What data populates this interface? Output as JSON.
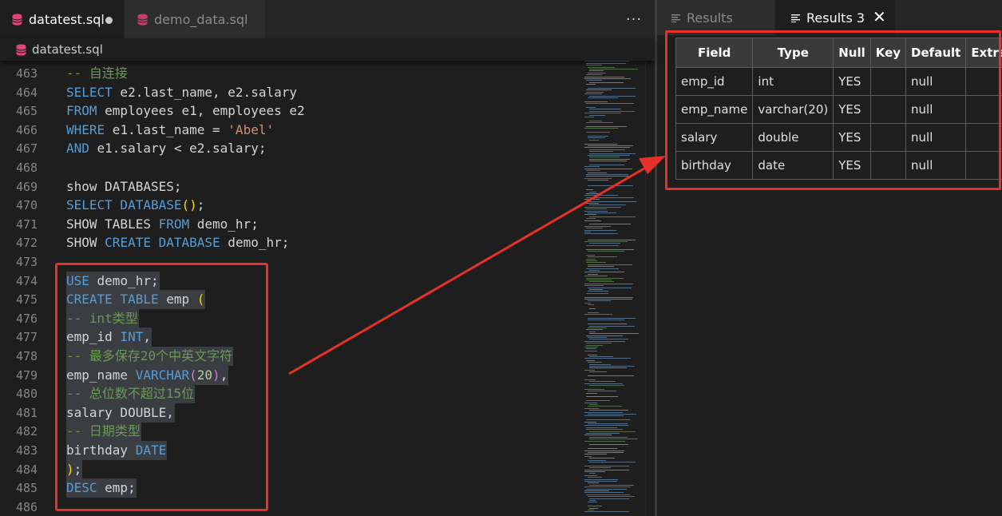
{
  "editor": {
    "tabs": [
      {
        "label": "datatest.sql",
        "active": true,
        "dirty": true
      },
      {
        "label": "demo_data.sql",
        "active": false,
        "dirty": false
      }
    ],
    "more_label": "···",
    "breadcrumb": "datatest.sql",
    "lines": [
      {
        "no": "463",
        "tokens": [
          {
            "c": "c",
            "t": "-- 自连接"
          }
        ]
      },
      {
        "no": "464",
        "tokens": [
          {
            "c": "k",
            "t": "SELECT"
          },
          {
            "c": "t",
            "t": " e2.last_name, e2.salary"
          }
        ]
      },
      {
        "no": "465",
        "tokens": [
          {
            "c": "k",
            "t": "FROM"
          },
          {
            "c": "t",
            "t": " employees e1, employees e2"
          }
        ]
      },
      {
        "no": "466",
        "tokens": [
          {
            "c": "k",
            "t": "WHERE"
          },
          {
            "c": "t",
            "t": " e1.last_name = "
          },
          {
            "c": "s",
            "t": "'Abel'"
          }
        ]
      },
      {
        "no": "467",
        "tokens": [
          {
            "c": "k",
            "t": "AND"
          },
          {
            "c": "t",
            "t": " e1.salary < e2.salary;"
          }
        ]
      },
      {
        "no": "468",
        "tokens": []
      },
      {
        "no": "469",
        "tokens": [
          {
            "c": "t",
            "t": "show DATABASES;"
          }
        ]
      },
      {
        "no": "470",
        "tokens": [
          {
            "c": "k",
            "t": "SELECT DATABASE"
          },
          {
            "c": "b",
            "t": "()"
          },
          {
            "c": "t",
            "t": ";"
          }
        ]
      },
      {
        "no": "471",
        "tokens": [
          {
            "c": "t",
            "t": "SHOW TABLES "
          },
          {
            "c": "k",
            "t": "FROM"
          },
          {
            "c": "t",
            "t": " demo_hr;"
          }
        ]
      },
      {
        "no": "472",
        "tokens": [
          {
            "c": "t",
            "t": "SHOW "
          },
          {
            "c": "k",
            "t": "CREATE DATABASE"
          },
          {
            "c": "t",
            "t": " demo_hr;"
          }
        ]
      },
      {
        "no": "473",
        "tokens": []
      },
      {
        "no": "474",
        "sel": true,
        "tokens": [
          {
            "c": "k",
            "t": "USE"
          },
          {
            "c": "t",
            "t": " demo_hr;"
          }
        ]
      },
      {
        "no": "475",
        "sel": true,
        "tokens": [
          {
            "c": "k",
            "t": "CREATE TABLE"
          },
          {
            "c": "t",
            "t": " emp "
          },
          {
            "c": "b",
            "t": "("
          }
        ]
      },
      {
        "no": "476",
        "sel": true,
        "tokens": [
          {
            "c": "c",
            "t": "-- int类型"
          }
        ]
      },
      {
        "no": "477",
        "sel": true,
        "tokens": [
          {
            "c": "t",
            "t": "emp_id "
          },
          {
            "c": "k",
            "t": "INT"
          },
          {
            "c": "t",
            "t": ","
          }
        ]
      },
      {
        "no": "478",
        "sel": true,
        "tokens": [
          {
            "c": "c",
            "t": "-- 最多保存20个中英文字符"
          }
        ]
      },
      {
        "no": "479",
        "sel": true,
        "tokens": [
          {
            "c": "t",
            "t": "emp_name "
          },
          {
            "c": "k",
            "t": "VARCHAR"
          },
          {
            "c": "p",
            "t": "("
          },
          {
            "c": "n",
            "t": "20"
          },
          {
            "c": "p",
            "t": ")"
          },
          {
            "c": "t",
            "t": ","
          }
        ]
      },
      {
        "no": "480",
        "sel": true,
        "tokens": [
          {
            "c": "c",
            "t": "-- 总位数不超过15位"
          }
        ]
      },
      {
        "no": "481",
        "sel": true,
        "tokens": [
          {
            "c": "t",
            "t": "salary DOUBLE,"
          }
        ]
      },
      {
        "no": "482",
        "sel": true,
        "tokens": [
          {
            "c": "c",
            "t": "-- 日期类型"
          }
        ]
      },
      {
        "no": "483",
        "sel": true,
        "tokens": [
          {
            "c": "t",
            "t": "birthday "
          },
          {
            "c": "k",
            "t": "DATE"
          }
        ]
      },
      {
        "no": "484",
        "sel": true,
        "tokens": [
          {
            "c": "b",
            "t": ")"
          },
          {
            "c": "t",
            "t": ";"
          }
        ]
      },
      {
        "no": "485",
        "sel": true,
        "tokens": [
          {
            "c": "k",
            "t": "DESC"
          },
          {
            "c": "t",
            "t": " emp;"
          }
        ]
      },
      {
        "no": "486",
        "tokens": []
      }
    ]
  },
  "results": {
    "tabs": [
      {
        "label": "Results",
        "active": false
      },
      {
        "label": "Results 3",
        "active": true
      }
    ],
    "close_label": "✕",
    "columns": [
      "Field",
      "Type",
      "Null",
      "Key",
      "Default",
      "Extra"
    ],
    "rows": [
      [
        "emp_id",
        "int",
        "YES",
        "",
        "null",
        ""
      ],
      [
        "emp_name",
        "varchar(20)",
        "YES",
        "",
        "null",
        ""
      ],
      [
        "salary",
        "double",
        "YES",
        "",
        "null",
        ""
      ],
      [
        "birthday",
        "date",
        "YES",
        "",
        "null",
        ""
      ]
    ]
  },
  "colors": {
    "annotation_red": "#e8302a",
    "db_icon": "#e0447a",
    "keyword": "#569cd6",
    "comment": "#6a9955"
  },
  "icons": {
    "file_icon": "database-icon",
    "results_icon": "list-lines-icon",
    "close_icon": "close-icon"
  }
}
